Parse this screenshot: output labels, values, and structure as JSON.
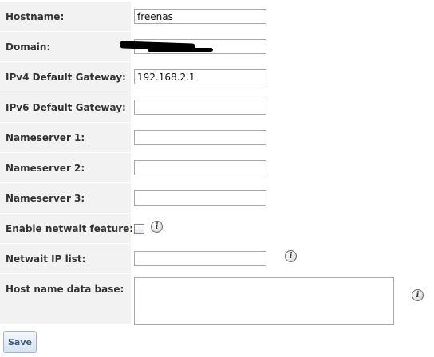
{
  "form": {
    "hostname": {
      "label": "Hostname:",
      "value": "freenas",
      "placeholder": ""
    },
    "domain": {
      "label": "Domain:",
      "value": "",
      "placeholder": ""
    },
    "ipv4_gateway": {
      "label": "IPv4 Default Gateway:",
      "value": "192.168.2.1",
      "placeholder": ""
    },
    "ipv6_gateway": {
      "label": "IPv6 Default Gateway:",
      "value": "",
      "placeholder": ""
    },
    "nameserver1": {
      "label": "Nameserver 1:",
      "value": "",
      "placeholder": ""
    },
    "nameserver2": {
      "label": "Nameserver 2:",
      "value": "",
      "placeholder": ""
    },
    "nameserver3": {
      "label": "Nameserver 3:",
      "value": "",
      "placeholder": ""
    },
    "netwait_enabled": {
      "label": "Enable netwait feature:",
      "checked": false,
      "info_icon": "info-icon"
    },
    "netwait_ip_list": {
      "label": "Netwait IP list:",
      "value": "",
      "placeholder": "",
      "info_icon": "info-icon"
    },
    "hosts_database": {
      "label": "Host name data base:",
      "value": "",
      "placeholder": "",
      "info_icon": "info-icon"
    }
  },
  "actions": {
    "save_label": "Save"
  },
  "colors": {
    "label_background": "#f2f2f2",
    "input_border": "#a9a9a9",
    "button_text": "#3a5a80",
    "redaction": "#000000"
  }
}
